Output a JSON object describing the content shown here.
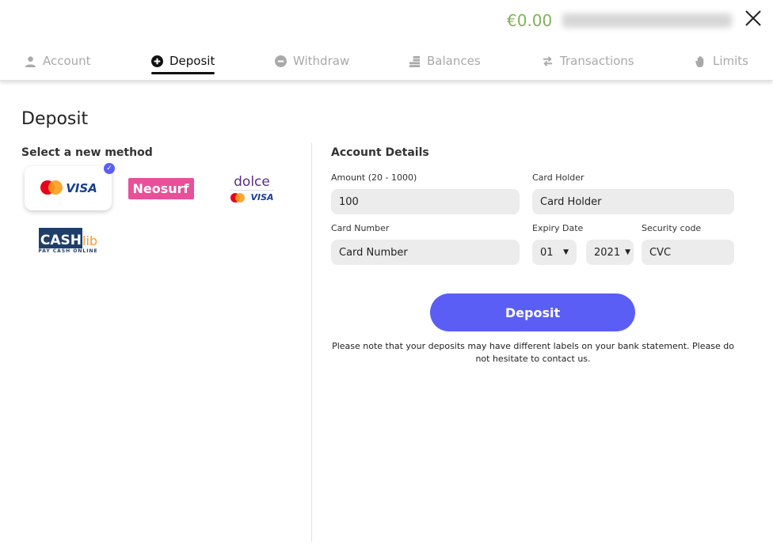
{
  "header": {
    "balance": "€0.00",
    "user_name_blurred": true
  },
  "tabs": [
    {
      "label": "Account",
      "icon": "user-icon"
    },
    {
      "label": "Deposit",
      "icon": "plus-circle-icon",
      "active": true
    },
    {
      "label": "Withdraw",
      "icon": "minus-circle-icon"
    },
    {
      "label": "Balances",
      "icon": "coins-icon"
    },
    {
      "label": "Transactions",
      "icon": "arrows-exchange-icon"
    },
    {
      "label": "Limits",
      "icon": "hand-icon"
    }
  ],
  "page_title": "Deposit",
  "methods": {
    "heading": "Select a new method",
    "items": [
      {
        "name": "Mastercard VISA",
        "logo_text": "VISA",
        "selected": true
      },
      {
        "name": "Neosurf",
        "logo_text": "Neosurf"
      },
      {
        "name": "dolce",
        "logo_text": "dolce",
        "logo_text2": "VISA"
      },
      {
        "name": "CASHlib",
        "logo_text": "CASH",
        "logo_text2": "lib",
        "logo_text3": "PAY CASH ONLINE"
      }
    ]
  },
  "form": {
    "heading": "Account Details",
    "amount_label": "Amount (20 - 1000)",
    "amount_value": "100",
    "holder_label": "Card Holder",
    "holder_placeholder": "Card Holder",
    "number_label": "Card Number",
    "number_placeholder": "Card Number",
    "expiry_label": "Expiry Date",
    "expiry_month": "01",
    "expiry_year": "2021",
    "cvc_label": "Security code",
    "cvc_placeholder": "CVC",
    "submit": "Deposit",
    "note": "Please note that your deposits may have different labels on your bank statement. Please do not hesitate to contact us."
  },
  "colors": {
    "accent": "#5b5ef5",
    "balance": "#7cb35a"
  }
}
